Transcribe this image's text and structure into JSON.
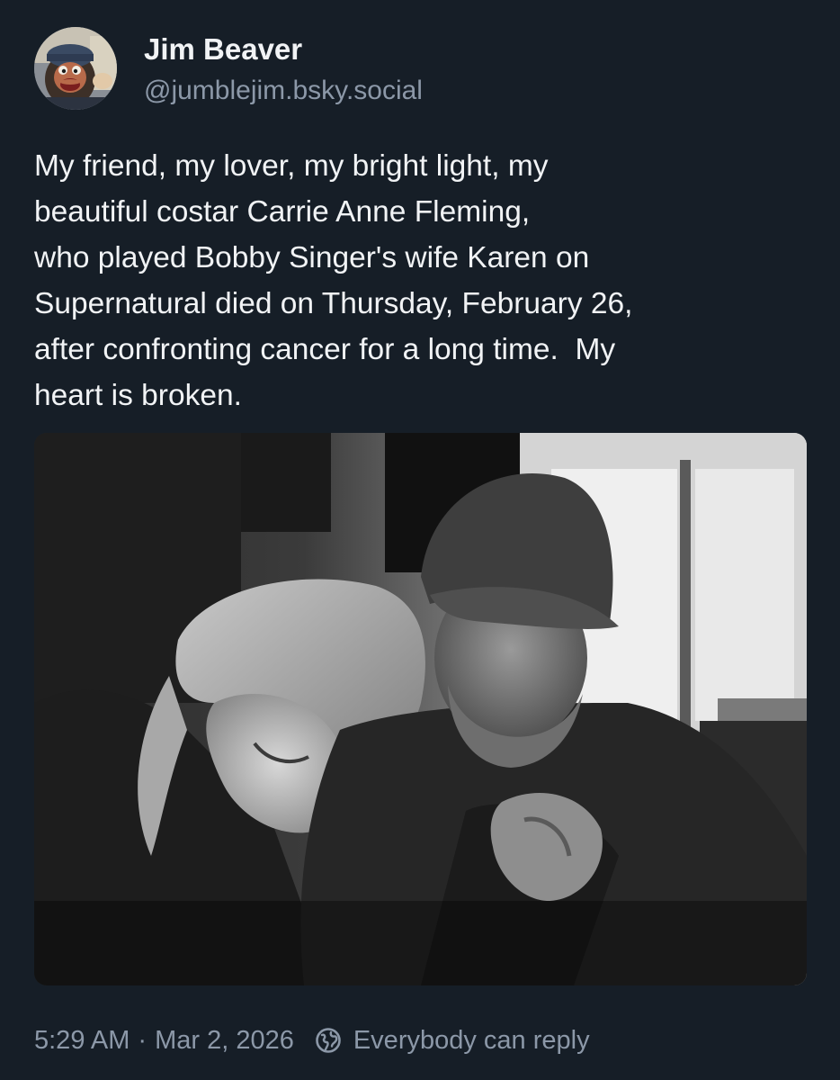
{
  "author": {
    "display_name": "Jim Beaver",
    "handle": "@jumblejim.bsky.social",
    "avatar_icon": "puppet-avatar"
  },
  "post": {
    "text": "My friend, my lover, my bright light, my\nbeautiful costar Carrie Anne Fleming,\nwho played Bobby Singer's wife Karen on\nSupernatural died on Thursday, February 26,\nafter confronting cancer for a long time.  My\nheart is broken.",
    "image": "black-and-white photo of a smiling woman resting her head on the shoulder of a bearded man in a cap"
  },
  "meta": {
    "time": "5:29 AM",
    "separator": "·",
    "date": "Mar 2, 2026",
    "reply_icon": "globe-icon",
    "reply_setting": "Everybody can reply"
  },
  "colors": {
    "background": "#161e27",
    "text": "#f1f3f5",
    "muted": "#8c98a8"
  }
}
